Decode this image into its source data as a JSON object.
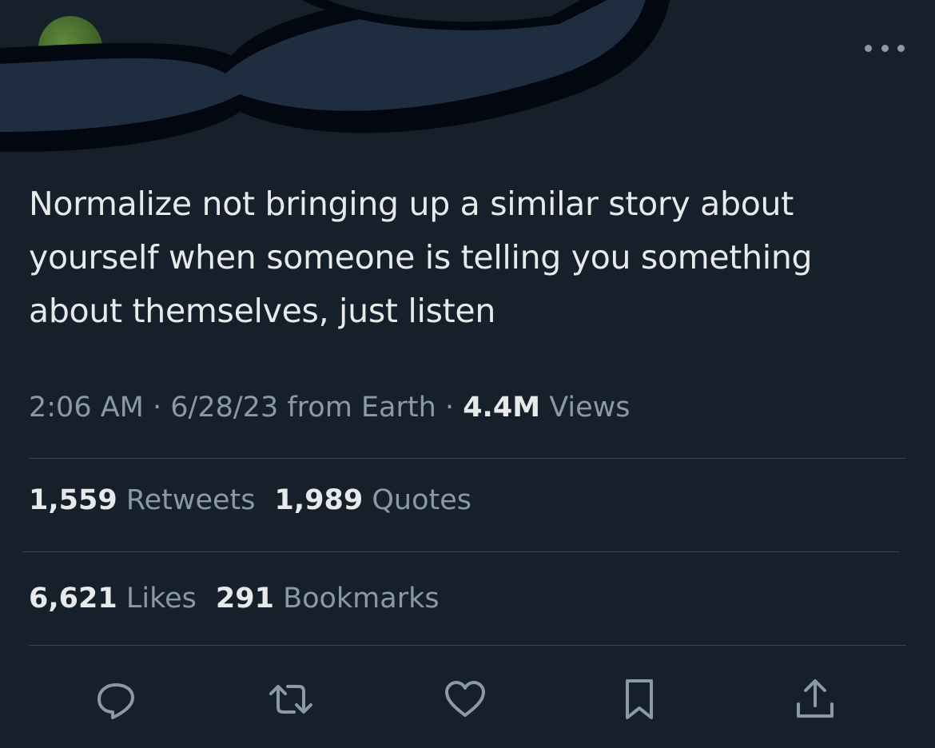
{
  "tweet": {
    "text": "Normalize not bringing up a similar story about yourself when someone is telling you something about themselves, just listen",
    "time": "2:06 AM",
    "date": "6/28/23",
    "source": "from Earth",
    "views_count": "4.4M",
    "views_label": "Views"
  },
  "stats": {
    "retweets_count": "1,559",
    "retweets_label": "Retweets",
    "quotes_count": "1,989",
    "quotes_label": "Quotes",
    "likes_count": "6,621",
    "likes_label": "Likes",
    "bookmarks_count": "291",
    "bookmarks_label": "Bookmarks"
  },
  "icons": {
    "more": "more-horizontal-icon",
    "reply": "reply-icon",
    "retweet": "retweet-icon",
    "like": "heart-icon",
    "bookmark": "bookmark-icon",
    "share": "share-icon"
  },
  "colors": {
    "background": "#16202b",
    "text": "#e7e9ea",
    "secondary_text": "#8b98a5",
    "divider": "#38444d",
    "scribble_fill": "#1e2d40",
    "scribble_outline": "#030810"
  }
}
